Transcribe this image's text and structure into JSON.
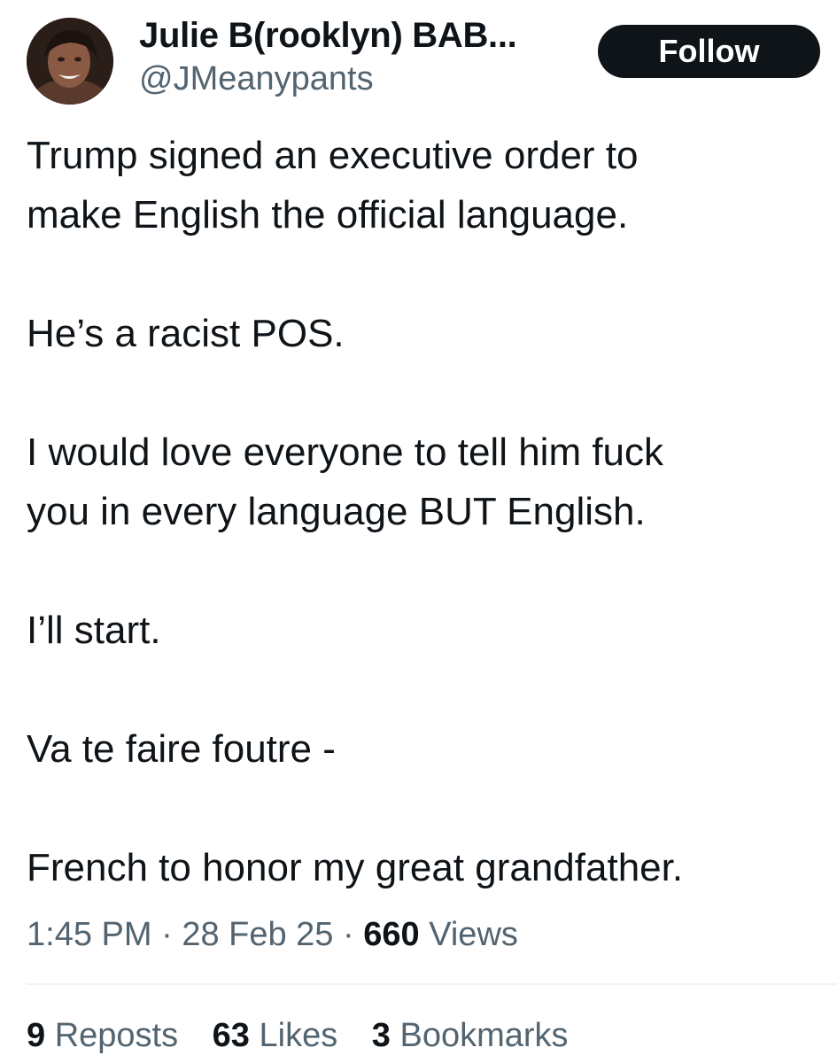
{
  "author": {
    "display_name": "Julie B(rooklyn) BAB...",
    "handle": "@JMeanypants",
    "follow_label": "Follow"
  },
  "tweet": {
    "paragraphs": [
      "Trump signed an executive order to",
      "make English the official language.",
      "He’s a racist POS.",
      "I would love everyone to tell him fuck",
      "you in every language BUT English.",
      "I’ll start.",
      "Va te faire foutre -",
      "French to honor my great grandfather."
    ]
  },
  "meta": {
    "time": "1:45 PM",
    "separator": "·",
    "date": "28 Feb 25",
    "views_count": "660",
    "views_label": "Views"
  },
  "stats": {
    "reposts_count": "9",
    "reposts_label": "Reposts",
    "likes_count": "63",
    "likes_label": "Likes",
    "bookmarks_count": "3",
    "bookmarks_label": "Bookmarks"
  },
  "colors": {
    "primary_text": "#0f1419",
    "secondary_text": "#536471",
    "follow_button_bg": "#0f1419",
    "follow_button_text": "#ffffff",
    "divider": "#eff3f4"
  }
}
